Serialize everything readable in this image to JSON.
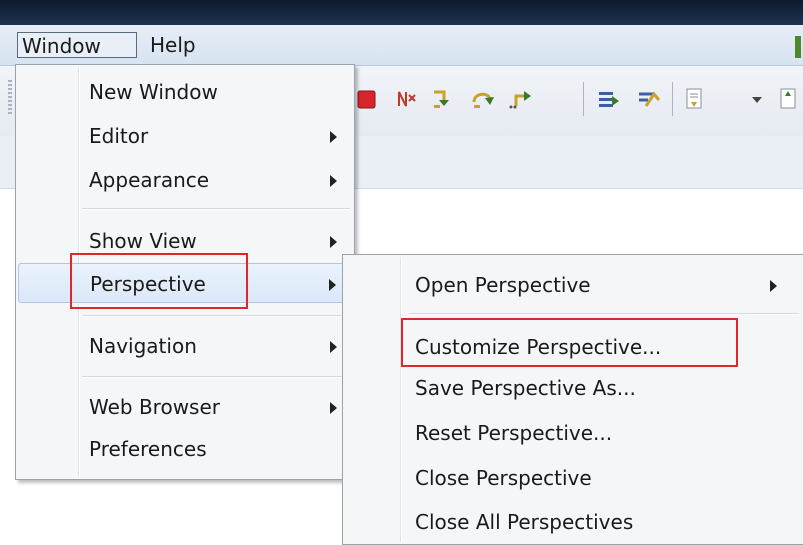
{
  "menubar": {
    "items": [
      {
        "label": "Window"
      },
      {
        "label": "Help"
      }
    ]
  },
  "window_menu": {
    "items": [
      {
        "label": "New Window",
        "has_submenu": false
      },
      {
        "label": "Editor",
        "has_submenu": true
      },
      {
        "label": "Appearance",
        "has_submenu": true
      },
      {
        "label": "Show View",
        "has_submenu": true
      },
      {
        "label": "Perspective",
        "has_submenu": true,
        "active": true
      },
      {
        "label": "Navigation",
        "has_submenu": true
      },
      {
        "label": "Web Browser",
        "has_submenu": true
      },
      {
        "label": "Preferences",
        "has_submenu": false
      }
    ]
  },
  "perspective_submenu": {
    "items": [
      {
        "label": "Open Perspective",
        "has_submenu": true
      },
      {
        "label": "Customize Perspective...",
        "highlighted": true
      },
      {
        "label": "Save Perspective As..."
      },
      {
        "label": "Reset Perspective..."
      },
      {
        "label": "Close Perspective"
      },
      {
        "label": "Close All Perspectives"
      }
    ]
  },
  "colors": {
    "annotation_red": "#e0262b",
    "active_item_bg": "#dbe8f8",
    "title_bar": "#1f3150"
  },
  "toolbar": {
    "icons": [
      "stop-icon",
      "disconnect-icon",
      "step-into-icon",
      "step-over-icon",
      "step-return-icon",
      "drop-to-frame-icon",
      "use-step-filters-icon",
      "next-annotation-icon",
      "dropdown-arrow-icon",
      "prev-annotation-icon"
    ]
  }
}
